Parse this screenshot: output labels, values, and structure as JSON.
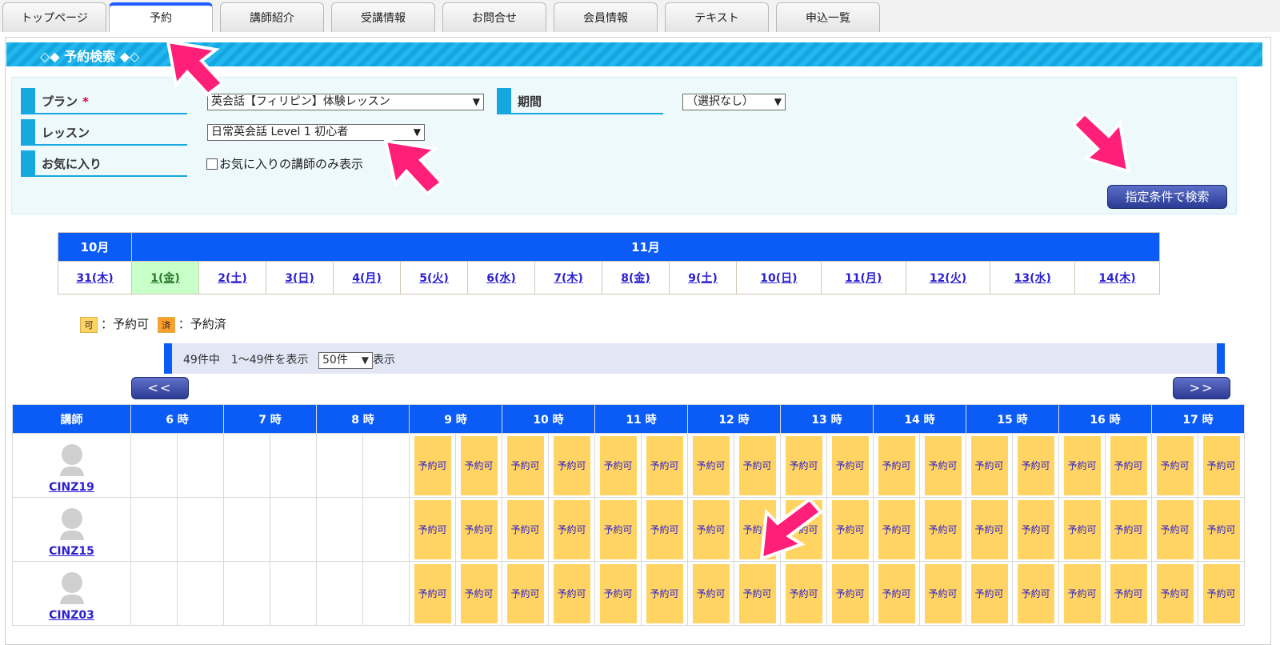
{
  "tabs": [
    {
      "label": "トップページ"
    },
    {
      "label": "予約"
    },
    {
      "label": "講師紹介"
    },
    {
      "label": "受講情報"
    },
    {
      "label": "お問合せ"
    },
    {
      "label": "会員情報"
    },
    {
      "label": "テキスト"
    },
    {
      "label": "申込一覧"
    }
  ],
  "section_title": "◇◆ 予約検索 ◆◇",
  "search": {
    "plan_label": "プラン",
    "plan_required": "*",
    "plan_value": "英会話【フィリピン】体験レッスン",
    "period_label": "期間",
    "period_value": "（選択なし）",
    "lesson_label": "レッスン",
    "lesson_value": "日常英会話 Level 1 初心者",
    "favorite_label": "お気に入り",
    "favorite_checkbox": "お気に入りの講師のみ表示",
    "search_button": "指定条件で検索"
  },
  "calendar": {
    "month1": "10月",
    "month2": "11月",
    "days": [
      "31(木)",
      "1(金)",
      "2(土)",
      "3(日)",
      "4(月)",
      "5(火)",
      "6(水)",
      "7(木)",
      "8(金)",
      "9(土)",
      "10(日)",
      "11(月)",
      "12(火)",
      "13(水)",
      "14(木)"
    ],
    "selected_index": 1
  },
  "legend": {
    "ok_badge": "可",
    "ok_text": "：予約可",
    "done_badge": "済",
    "done_text": "：予約済",
    "ok_color": "#ffd463",
    "done_color": "#ff9e2c"
  },
  "paging": {
    "summary": "49件中　1～49件を表示",
    "per_page": "50件",
    "suffix": "表示",
    "prev": "<<",
    "next": ">>"
  },
  "schedule": {
    "teacher_header": "講師",
    "hours": [
      "6 時",
      "7 時",
      "8 時",
      "9 時",
      "10 時",
      "11 時",
      "12 時",
      "13 時",
      "14 時",
      "15 時",
      "16 時",
      "17 時"
    ],
    "slot_label": "予約可",
    "teachers": [
      "CINZ19",
      "CINZ15",
      "CINZ03"
    ]
  }
}
